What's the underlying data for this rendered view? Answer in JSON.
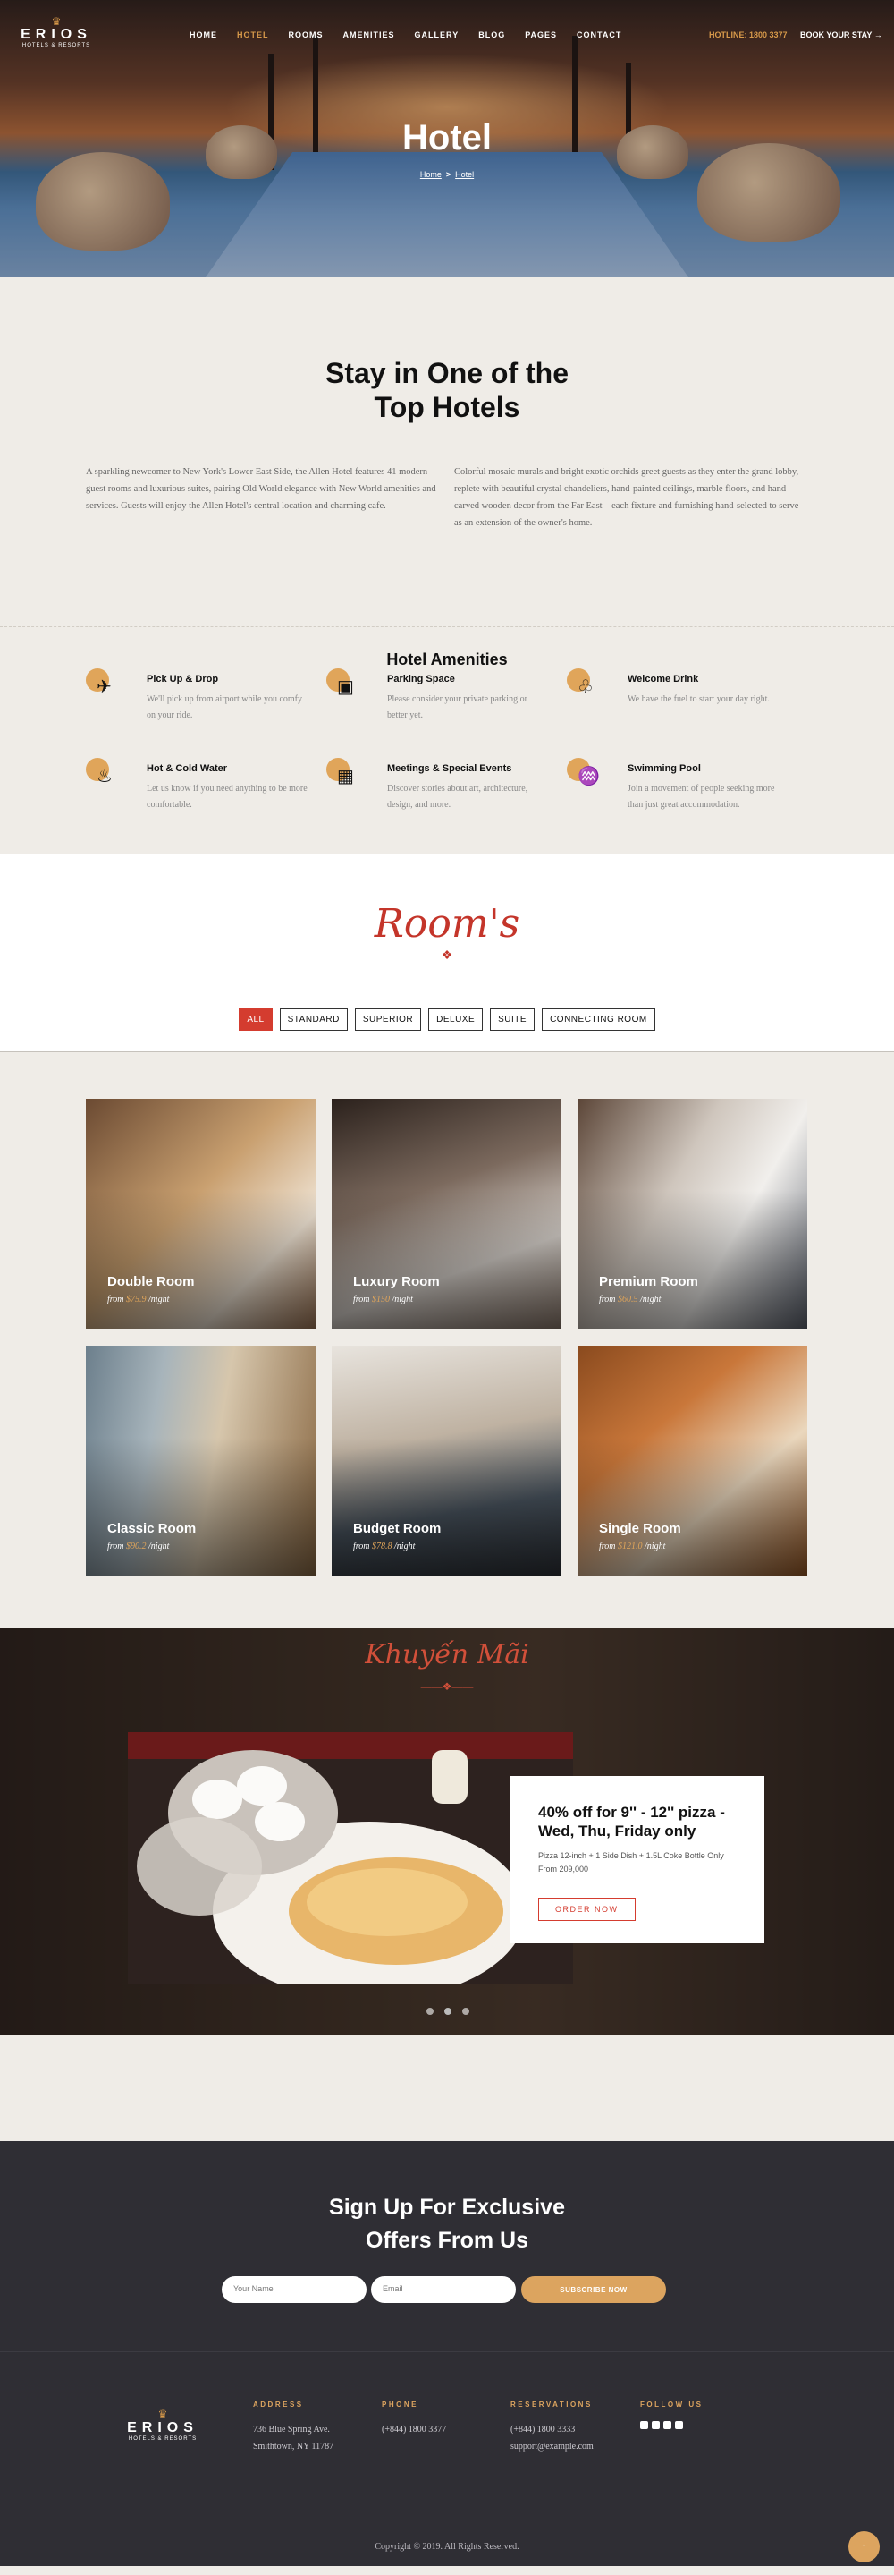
{
  "nav": {
    "logo_name": "ERIOS",
    "logo_sub": "HOTELS & RESORTS",
    "menu": [
      "HOME",
      "HOTEL",
      "ROOMS",
      "AMENITIES",
      "GALLERY",
      "BLOG",
      "PAGES",
      "CONTACT"
    ],
    "active_index": 1,
    "hotline": "HOTLINE: 1800 3377",
    "book": "BOOK YOUR STAY →"
  },
  "hero": {
    "title": "Hotel",
    "crumb_home": "Home",
    "crumb_sep": ">",
    "crumb_current": "Hotel"
  },
  "intro": {
    "title_line1": "Stay in One of the",
    "title_line2": "Top Hotels",
    "left": "A sparkling newcomer to New York's Lower East Side, the Allen Hotel features 41 modern guest rooms and luxurious suites, pairing Old World elegance with New World amenities and services. Guests will enjoy the Allen Hotel's central location and charming cafe.",
    "right": "Colorful mosaic murals and bright exotic orchids greet guests as they enter the grand lobby, replete with beautiful crystal chandeliers, hand-painted ceilings, marble floors, and hand-carved wooden decor from the Far East – each fixture and furnishing hand-selected to serve as an extension of the owner's home."
  },
  "amenities": {
    "title": "Hotel Amenities",
    "items": [
      {
        "title": "Pick Up & Drop",
        "desc": "We'll pick up from airport while you comfy on your ride.",
        "icon": "✈"
      },
      {
        "title": "Parking Space",
        "desc": "Please consider your private parking or better yet.",
        "icon": "▣"
      },
      {
        "title": "Welcome Drink",
        "desc": "We have the fuel to start your day right.",
        "icon": "♧"
      },
      {
        "title": "Hot & Cold Water",
        "desc": "Let us know if you need anything to be more comfortable.",
        "icon": "♨"
      },
      {
        "title": "Meetings & Special Events",
        "desc": "Discover stories about art, architecture, design, and more.",
        "icon": "▦"
      },
      {
        "title": "Swimming Pool",
        "desc": "Join a movement of people seeking more than just great accommodation.",
        "icon": "♒"
      }
    ]
  },
  "rooms": {
    "title": "Room's",
    "filters": [
      "ALL",
      "STANDARD",
      "SUPERIOR",
      "DELUXE",
      "SUITE",
      "CONNECTING ROOM"
    ],
    "active_filter": 0,
    "list": [
      {
        "name": "Double Room",
        "from": "from ",
        "price": "$75.9",
        "per": " /night"
      },
      {
        "name": "Luxury Room",
        "from": "from ",
        "price": "$150",
        "per": " /night"
      },
      {
        "name": "Premium Room",
        "from": "from ",
        "price": "$60.5",
        "per": " /night"
      },
      {
        "name": "Classic Room",
        "from": "from ",
        "price": "$90.2",
        "per": " /night"
      },
      {
        "name": "Budget Room",
        "from": "from ",
        "price": "$78.8",
        "per": " /night"
      },
      {
        "name": "Single Room",
        "from": "from ",
        "price": "$121.0",
        "per": " /night"
      }
    ]
  },
  "promo": {
    "title": "Khuyến Mãi",
    "heading": "40% off for 9'' - 12'' pizza - Wed, Thu, Friday only",
    "desc": "Pizza 12-inch + 1 Side Dish + 1.5L Coke Bottle Only From 209,000",
    "button": "ORDER NOW"
  },
  "signup": {
    "line1": "Sign Up For Exclusive",
    "line2": "Offers From Us",
    "name_placeholder": "Your Name",
    "email_placeholder": "Email",
    "button": "SUBSCRIBE NOW"
  },
  "footer": {
    "address_h": "ADDRESS",
    "address_1": "736 Blue Spring Ave.",
    "address_2": "Smithtown, NY 11787",
    "phone_h": "PHONE",
    "phone": "(+844) 1800 3377",
    "res_h": "RESERVATIONS",
    "res_phone": "(+844) 1800 3333",
    "res_email": "support@example.com",
    "follow_h": "FOLLOW US",
    "copyright": "Copyright © 2019. All Rights Reserved.",
    "to_top": "↑"
  },
  "colors": {
    "accent": "#dca45f",
    "red": "#d43c2f",
    "dark": "#2f2e34",
    "bg": "#efece7"
  }
}
